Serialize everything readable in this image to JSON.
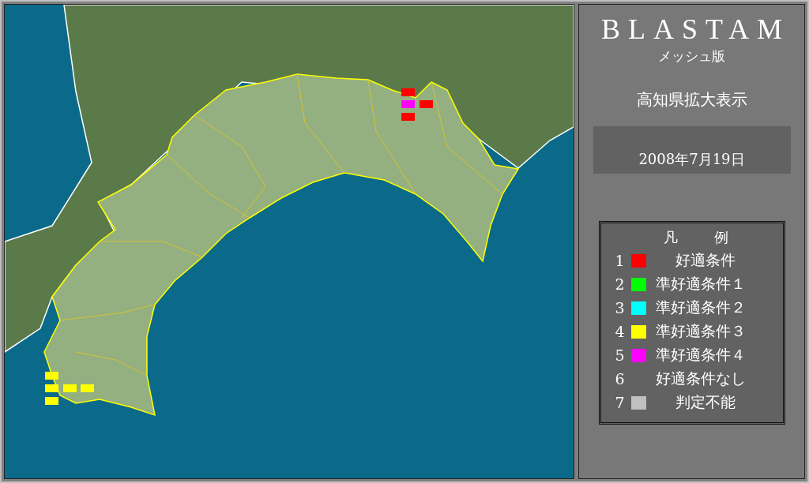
{
  "panel": {
    "title": "BLASTAM",
    "subtitle": "メッシュ版",
    "view": "高知県拡大表示",
    "date": "2008年7月19日"
  },
  "legend": {
    "title": [
      "凡",
      "例"
    ],
    "items": [
      {
        "number": "1",
        "label": "好適条件",
        "color": "#ff0000"
      },
      {
        "number": "2",
        "label": "準好適条件１",
        "color": "#00ff00"
      },
      {
        "number": "3",
        "label": "準好適条件２",
        "color": "#00ffff"
      },
      {
        "number": "4",
        "label": "準好適条件３",
        "color": "#ffff00"
      },
      {
        "number": "5",
        "label": "準好適条件４",
        "color": "#ff00ff"
      },
      {
        "number": "6",
        "label": "好適条件なし"
      },
      {
        "number": "7",
        "label": "判定不能",
        "color": "#c0c0c0"
      }
    ]
  },
  "map": {
    "markers": [
      {
        "color": "#ff0000"
      },
      {
        "color": "#ff00ff"
      },
      {
        "color": "#ff0000"
      },
      {
        "color": "#ff0000"
      },
      {
        "color": "#ffff00"
      },
      {
        "color": "#ffff00"
      },
      {
        "color": "#ffff00"
      },
      {
        "color": "#ffff00"
      },
      {
        "color": "#ffff00"
      }
    ]
  }
}
